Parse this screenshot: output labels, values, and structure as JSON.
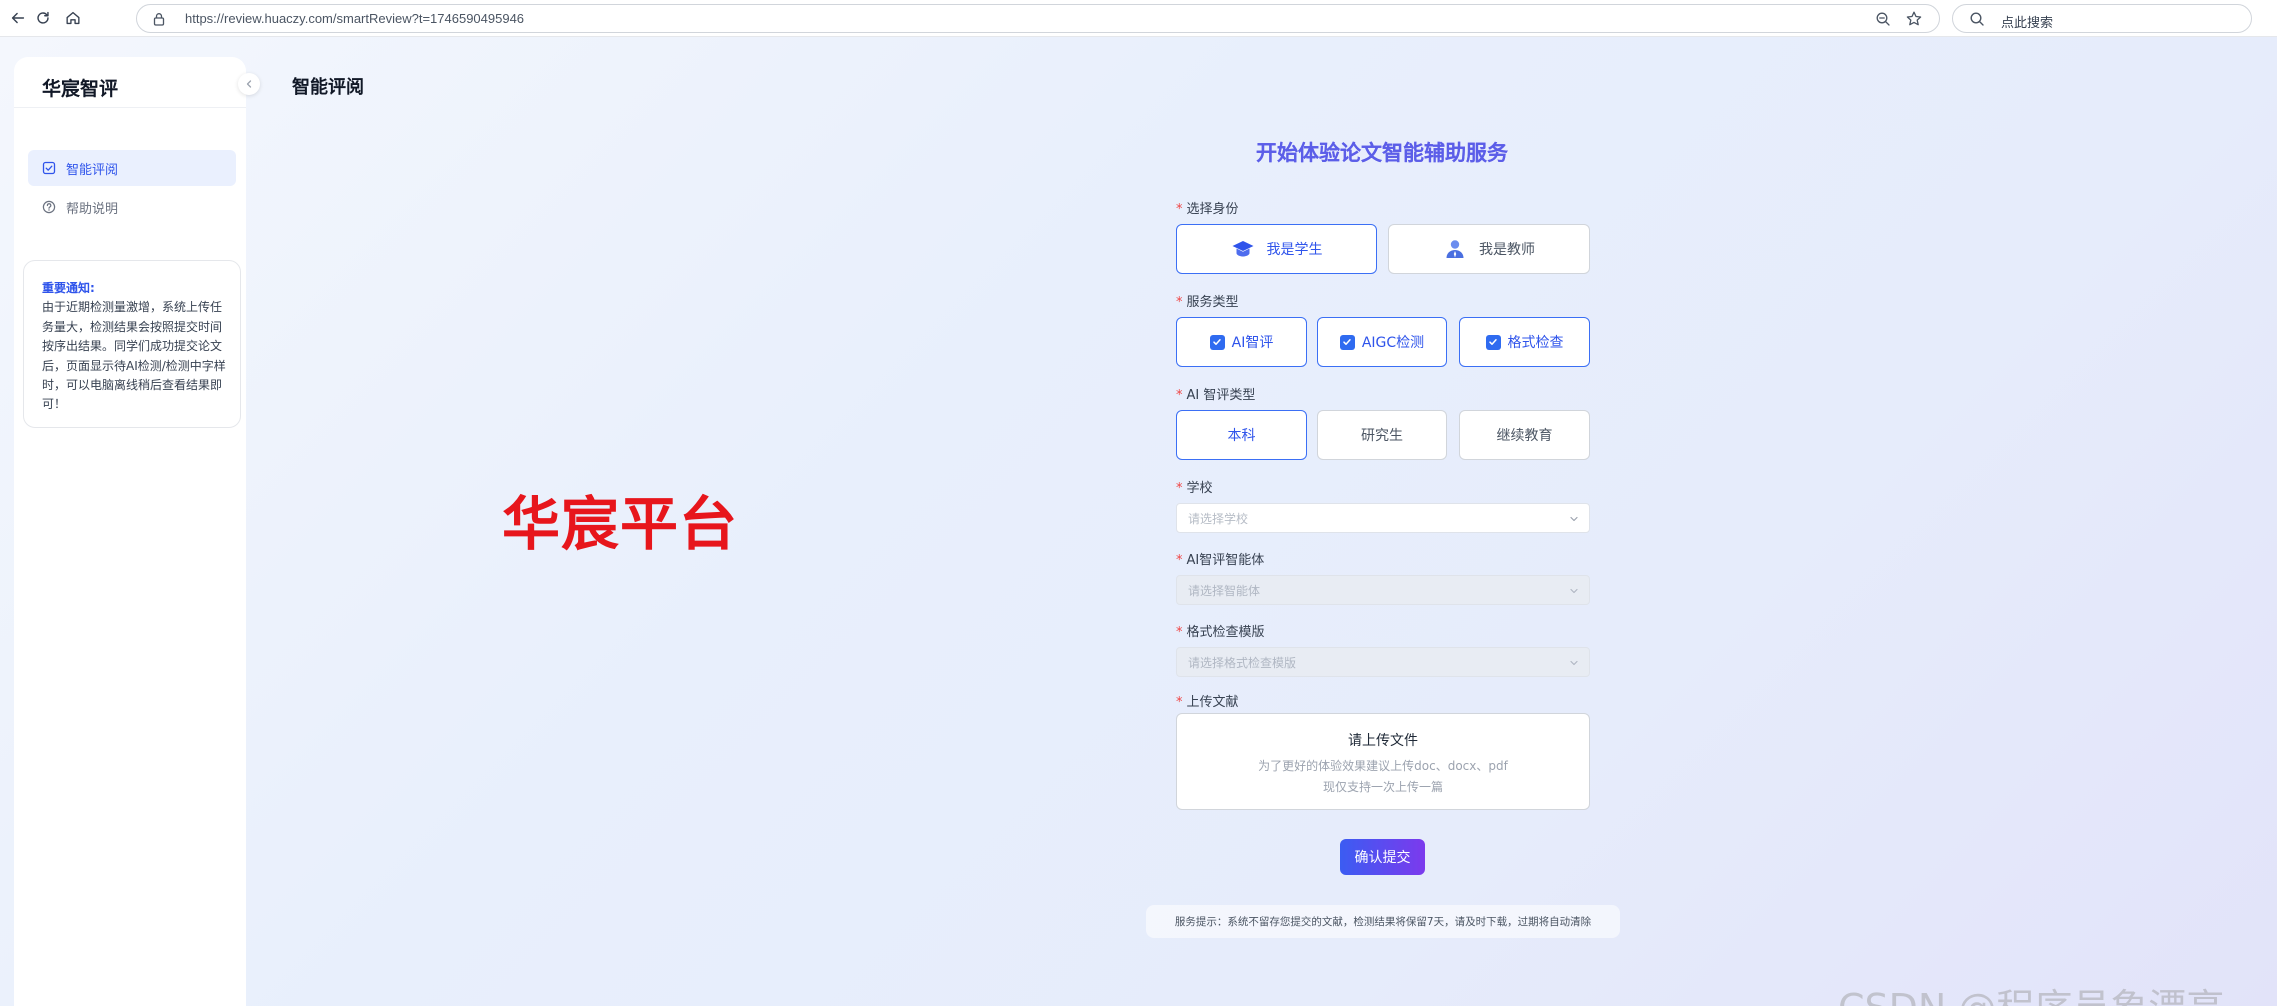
{
  "browser": {
    "url": "https://review.huaczy.com/smartReview?t=1746590495946",
    "search_placeholder": "点此搜索",
    "icons": [
      "back-icon",
      "reload-icon",
      "home-icon",
      "lock-icon",
      "zoom-out-icon",
      "star-icon",
      "search-icon"
    ]
  },
  "sidebar": {
    "brand": "华宸智评",
    "items": [
      {
        "label": "智能评阅",
        "icon": "checkbox-icon",
        "active": true
      },
      {
        "label": "帮助说明",
        "icon": "help-circle-icon",
        "active": false
      }
    ],
    "notice": {
      "title": "重要通知:",
      "body": "由于近期检测量激增，系统上传任务量大，检测结果会按照提交时间按序出结果。同学们成功提交论文后，页面显示待AI检测/检测中字样时，可以电脑离线稍后查看结果即可！"
    }
  },
  "header": {
    "page_title": "智能评阅"
  },
  "overlay": {
    "platform_text": "华宸平台",
    "csdn_text": "CSDN @程序员象漂亮"
  },
  "form": {
    "title": "开始体验论文智能辅助服务",
    "identity": {
      "label": "选择身份",
      "options": [
        {
          "label": "我是学生",
          "icon": "graduation-cap-icon",
          "selected": true
        },
        {
          "label": "我是教师",
          "icon": "teacher-icon",
          "selected": false
        }
      ]
    },
    "service_type": {
      "label": "服务类型",
      "options": [
        {
          "label": "AI智评",
          "checked": true
        },
        {
          "label": "AIGC检测",
          "checked": true
        },
        {
          "label": "格式检查",
          "checked": true
        }
      ]
    },
    "ai_type": {
      "label": "AI 智评类型",
      "options": [
        {
          "label": "本科",
          "selected": true
        },
        {
          "label": "研究生",
          "selected": false
        },
        {
          "label": "继续教育",
          "selected": false
        }
      ]
    },
    "school": {
      "label": "学校",
      "placeholder": "请选择学校"
    },
    "agent": {
      "label": "AI智评智能体",
      "placeholder": "请选择智能体"
    },
    "template": {
      "label": "格式检查模版",
      "placeholder": "请选择格式检查模版"
    },
    "upload": {
      "label": "上传文献",
      "title": "请上传文件",
      "hint1": "为了更好的体验效果建议上传doc、docx、pdf",
      "hint2": "现仅支持一次上传一篇"
    },
    "submit_label": "确认提交",
    "service_tip": "服务提示：系统不留存您提交的文献，检测结果将保留7天，请及时下载，过期将自动清除"
  },
  "colors": {
    "accent": "#2f54eb",
    "required": "#ef4444",
    "overlay_red": "#e7161c"
  }
}
